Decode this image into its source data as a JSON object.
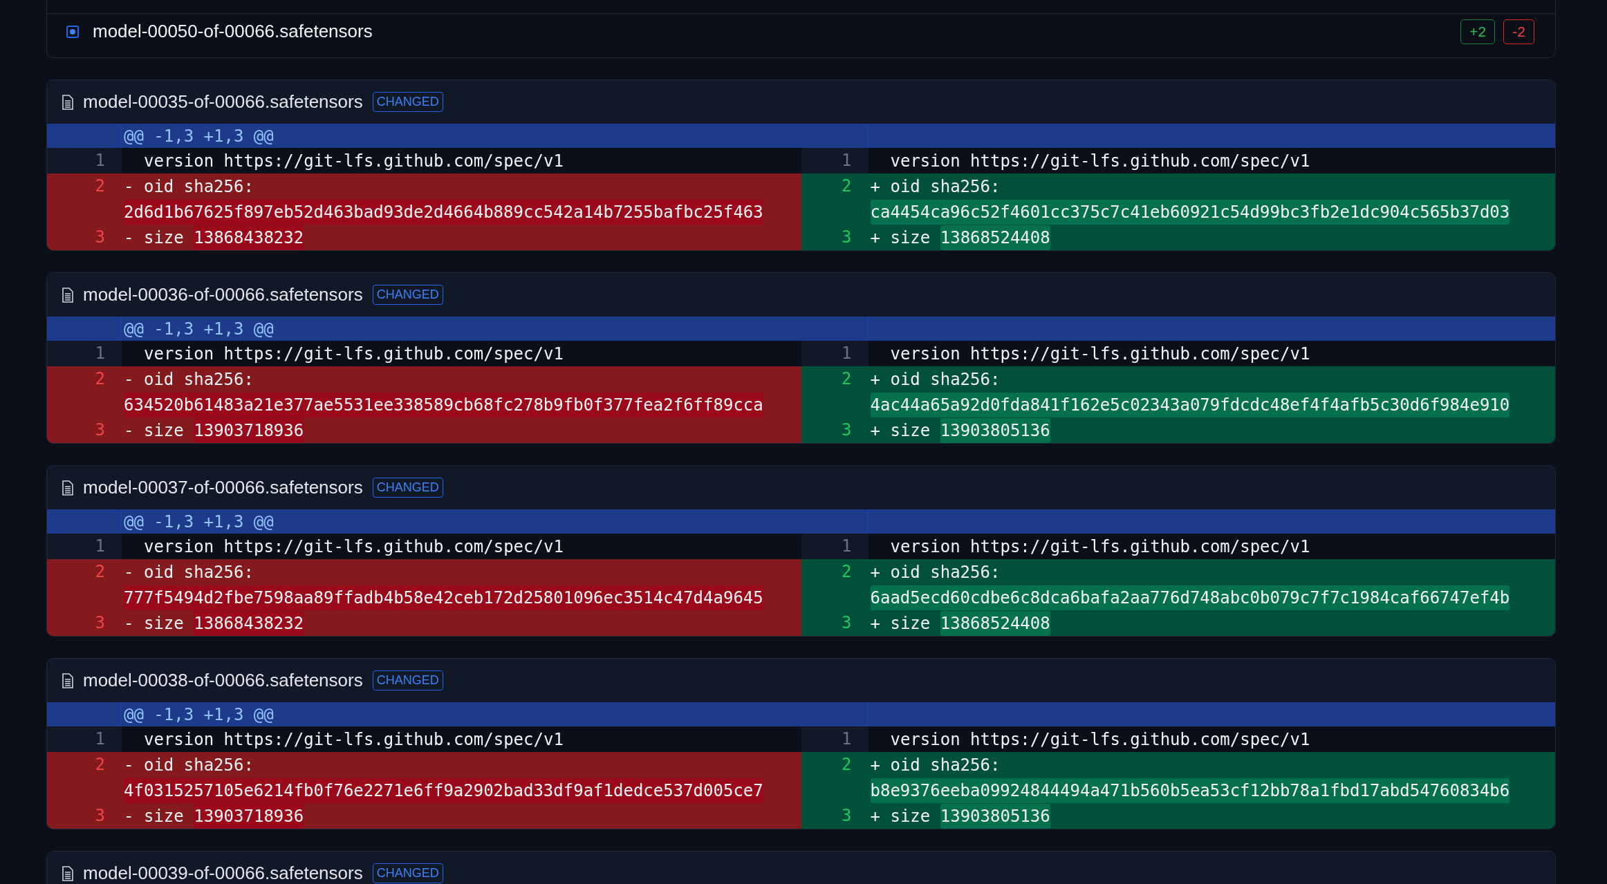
{
  "file_list": [
    {
      "name": "model-00050-of-00066.safetensors",
      "selected": true,
      "additions": "+2",
      "deletions": "-2"
    }
  ],
  "diffs": [
    {
      "file": "model-00035-of-00066.safetensors",
      "status": "CHANGED",
      "hunk": "@@ -1,3 +1,3 @@",
      "left": [
        {
          "number": "1",
          "kind": "context",
          "text": "version https://git-lfs.github.com/spec/v1"
        },
        {
          "number": "2",
          "kind": "removed",
          "marker": "-",
          "text": "oid sha256:",
          "changed": "2d6d1b67625f897eb52d463bad93de2d4664b889cc542a14b7255bafbc25f463"
        },
        {
          "number": "3",
          "kind": "removed",
          "marker": "-",
          "text": "size",
          "changed": "13868438232"
        }
      ],
      "right": [
        {
          "number": "1",
          "kind": "context",
          "text": "version https://git-lfs.github.com/spec/v1"
        },
        {
          "number": "2",
          "kind": "added",
          "marker": "+",
          "text": "oid sha256:",
          "changed": "ca4454ca96c52f4601cc375c7c41eb60921c54d99bc3fb2e1dc904c565b37d03"
        },
        {
          "number": "3",
          "kind": "added",
          "marker": "+",
          "text": "size",
          "changed": "13868524408"
        }
      ]
    },
    {
      "file": "model-00036-of-00066.safetensors",
      "status": "CHANGED",
      "hunk": "@@ -1,3 +1,3 @@",
      "left": [
        {
          "number": "1",
          "kind": "context",
          "text": "version https://git-lfs.github.com/spec/v1"
        },
        {
          "number": "2",
          "kind": "removed",
          "marker": "-",
          "text": "oid sha256:",
          "changed": "634520b61483a21e377ae5531ee338589cb68fc278b9fb0f377fea2f6ff89cca"
        },
        {
          "number": "3",
          "kind": "removed",
          "marker": "-",
          "text": "size",
          "changed": "13903718936"
        }
      ],
      "right": [
        {
          "number": "1",
          "kind": "context",
          "text": "version https://git-lfs.github.com/spec/v1"
        },
        {
          "number": "2",
          "kind": "added",
          "marker": "+",
          "text": "oid sha256:",
          "changed": "4ac44a65a92d0fda841f162e5c02343a079fdcdc48ef4f4afb5c30d6f984e910"
        },
        {
          "number": "3",
          "kind": "added",
          "marker": "+",
          "text": "size",
          "changed": "13903805136"
        }
      ]
    },
    {
      "file": "model-00037-of-00066.safetensors",
      "status": "CHANGED",
      "hunk": "@@ -1,3 +1,3 @@",
      "left": [
        {
          "number": "1",
          "kind": "context",
          "text": "version https://git-lfs.github.com/spec/v1"
        },
        {
          "number": "2",
          "kind": "removed",
          "marker": "-",
          "text": "oid sha256:",
          "changed": "777f5494d2fbe7598aa89ffadb4b58e42ceb172d25801096ec3514c47d4a9645"
        },
        {
          "number": "3",
          "kind": "removed",
          "marker": "-",
          "text": "size",
          "changed": "13868438232"
        }
      ],
      "right": [
        {
          "number": "1",
          "kind": "context",
          "text": "version https://git-lfs.github.com/spec/v1"
        },
        {
          "number": "2",
          "kind": "added",
          "marker": "+",
          "text": "oid sha256:",
          "changed": "6aad5ecd60cdbe6c8dca6bafa2aa776d748abc0b079c7f7c1984caf66747ef4b"
        },
        {
          "number": "3",
          "kind": "added",
          "marker": "+",
          "text": "size",
          "changed": "13868524408"
        }
      ]
    },
    {
      "file": "model-00038-of-00066.safetensors",
      "status": "CHANGED",
      "hunk": "@@ -1,3 +1,3 @@",
      "left": [
        {
          "number": "1",
          "kind": "context",
          "text": "version https://git-lfs.github.com/spec/v1"
        },
        {
          "number": "2",
          "kind": "removed",
          "marker": "-",
          "text": "oid sha256:",
          "changed": "4f0315257105e6214fb0f76e2271e6ff9a2902bad33df9af1dedce537d005ce7"
        },
        {
          "number": "3",
          "kind": "removed",
          "marker": "-",
          "text": "size",
          "changed": "13903718936"
        }
      ],
      "right": [
        {
          "number": "1",
          "kind": "context",
          "text": "version https://git-lfs.github.com/spec/v1"
        },
        {
          "number": "2",
          "kind": "added",
          "marker": "+",
          "text": "oid sha256:",
          "changed": "b8e9376eeba09924844494a471b560b5ea53cf12bb78a1fbd17abd54760834b6"
        },
        {
          "number": "3",
          "kind": "added",
          "marker": "+",
          "text": "size",
          "changed": "13903805136"
        }
      ]
    },
    {
      "file": "model-00039-of-00066.safetensors",
      "status": "CHANGED"
    }
  ]
}
